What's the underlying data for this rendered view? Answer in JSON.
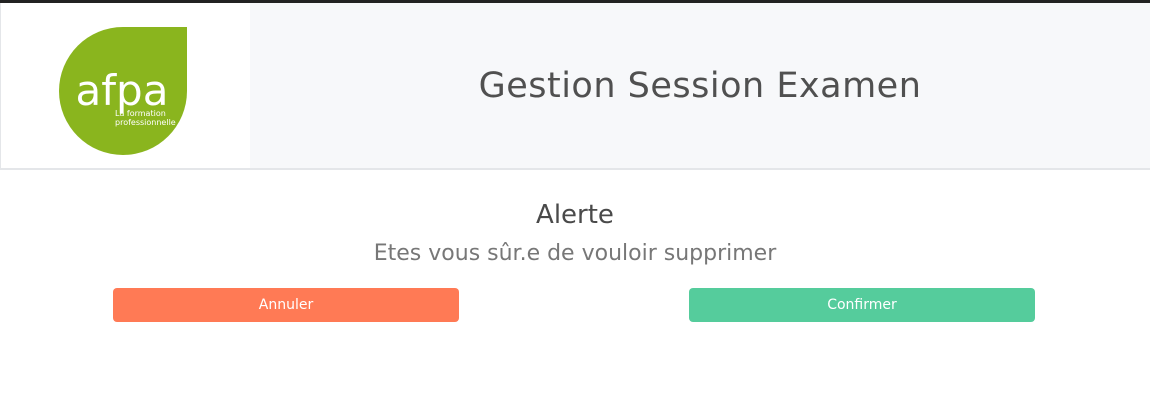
{
  "header": {
    "logo": {
      "brand": "afpa",
      "tagline_line1": "La formation",
      "tagline_line2": "professionnelle",
      "color": "#8ab51e"
    },
    "title": "Gestion Session Examen"
  },
  "alert": {
    "title": "Alerte",
    "message": "Etes vous sûr.e de vouloir supprimer"
  },
  "buttons": {
    "cancel_label": "Annuler",
    "confirm_label": "Confirmer",
    "cancel_color": "#ff7a55",
    "confirm_color": "#55cc9c"
  }
}
